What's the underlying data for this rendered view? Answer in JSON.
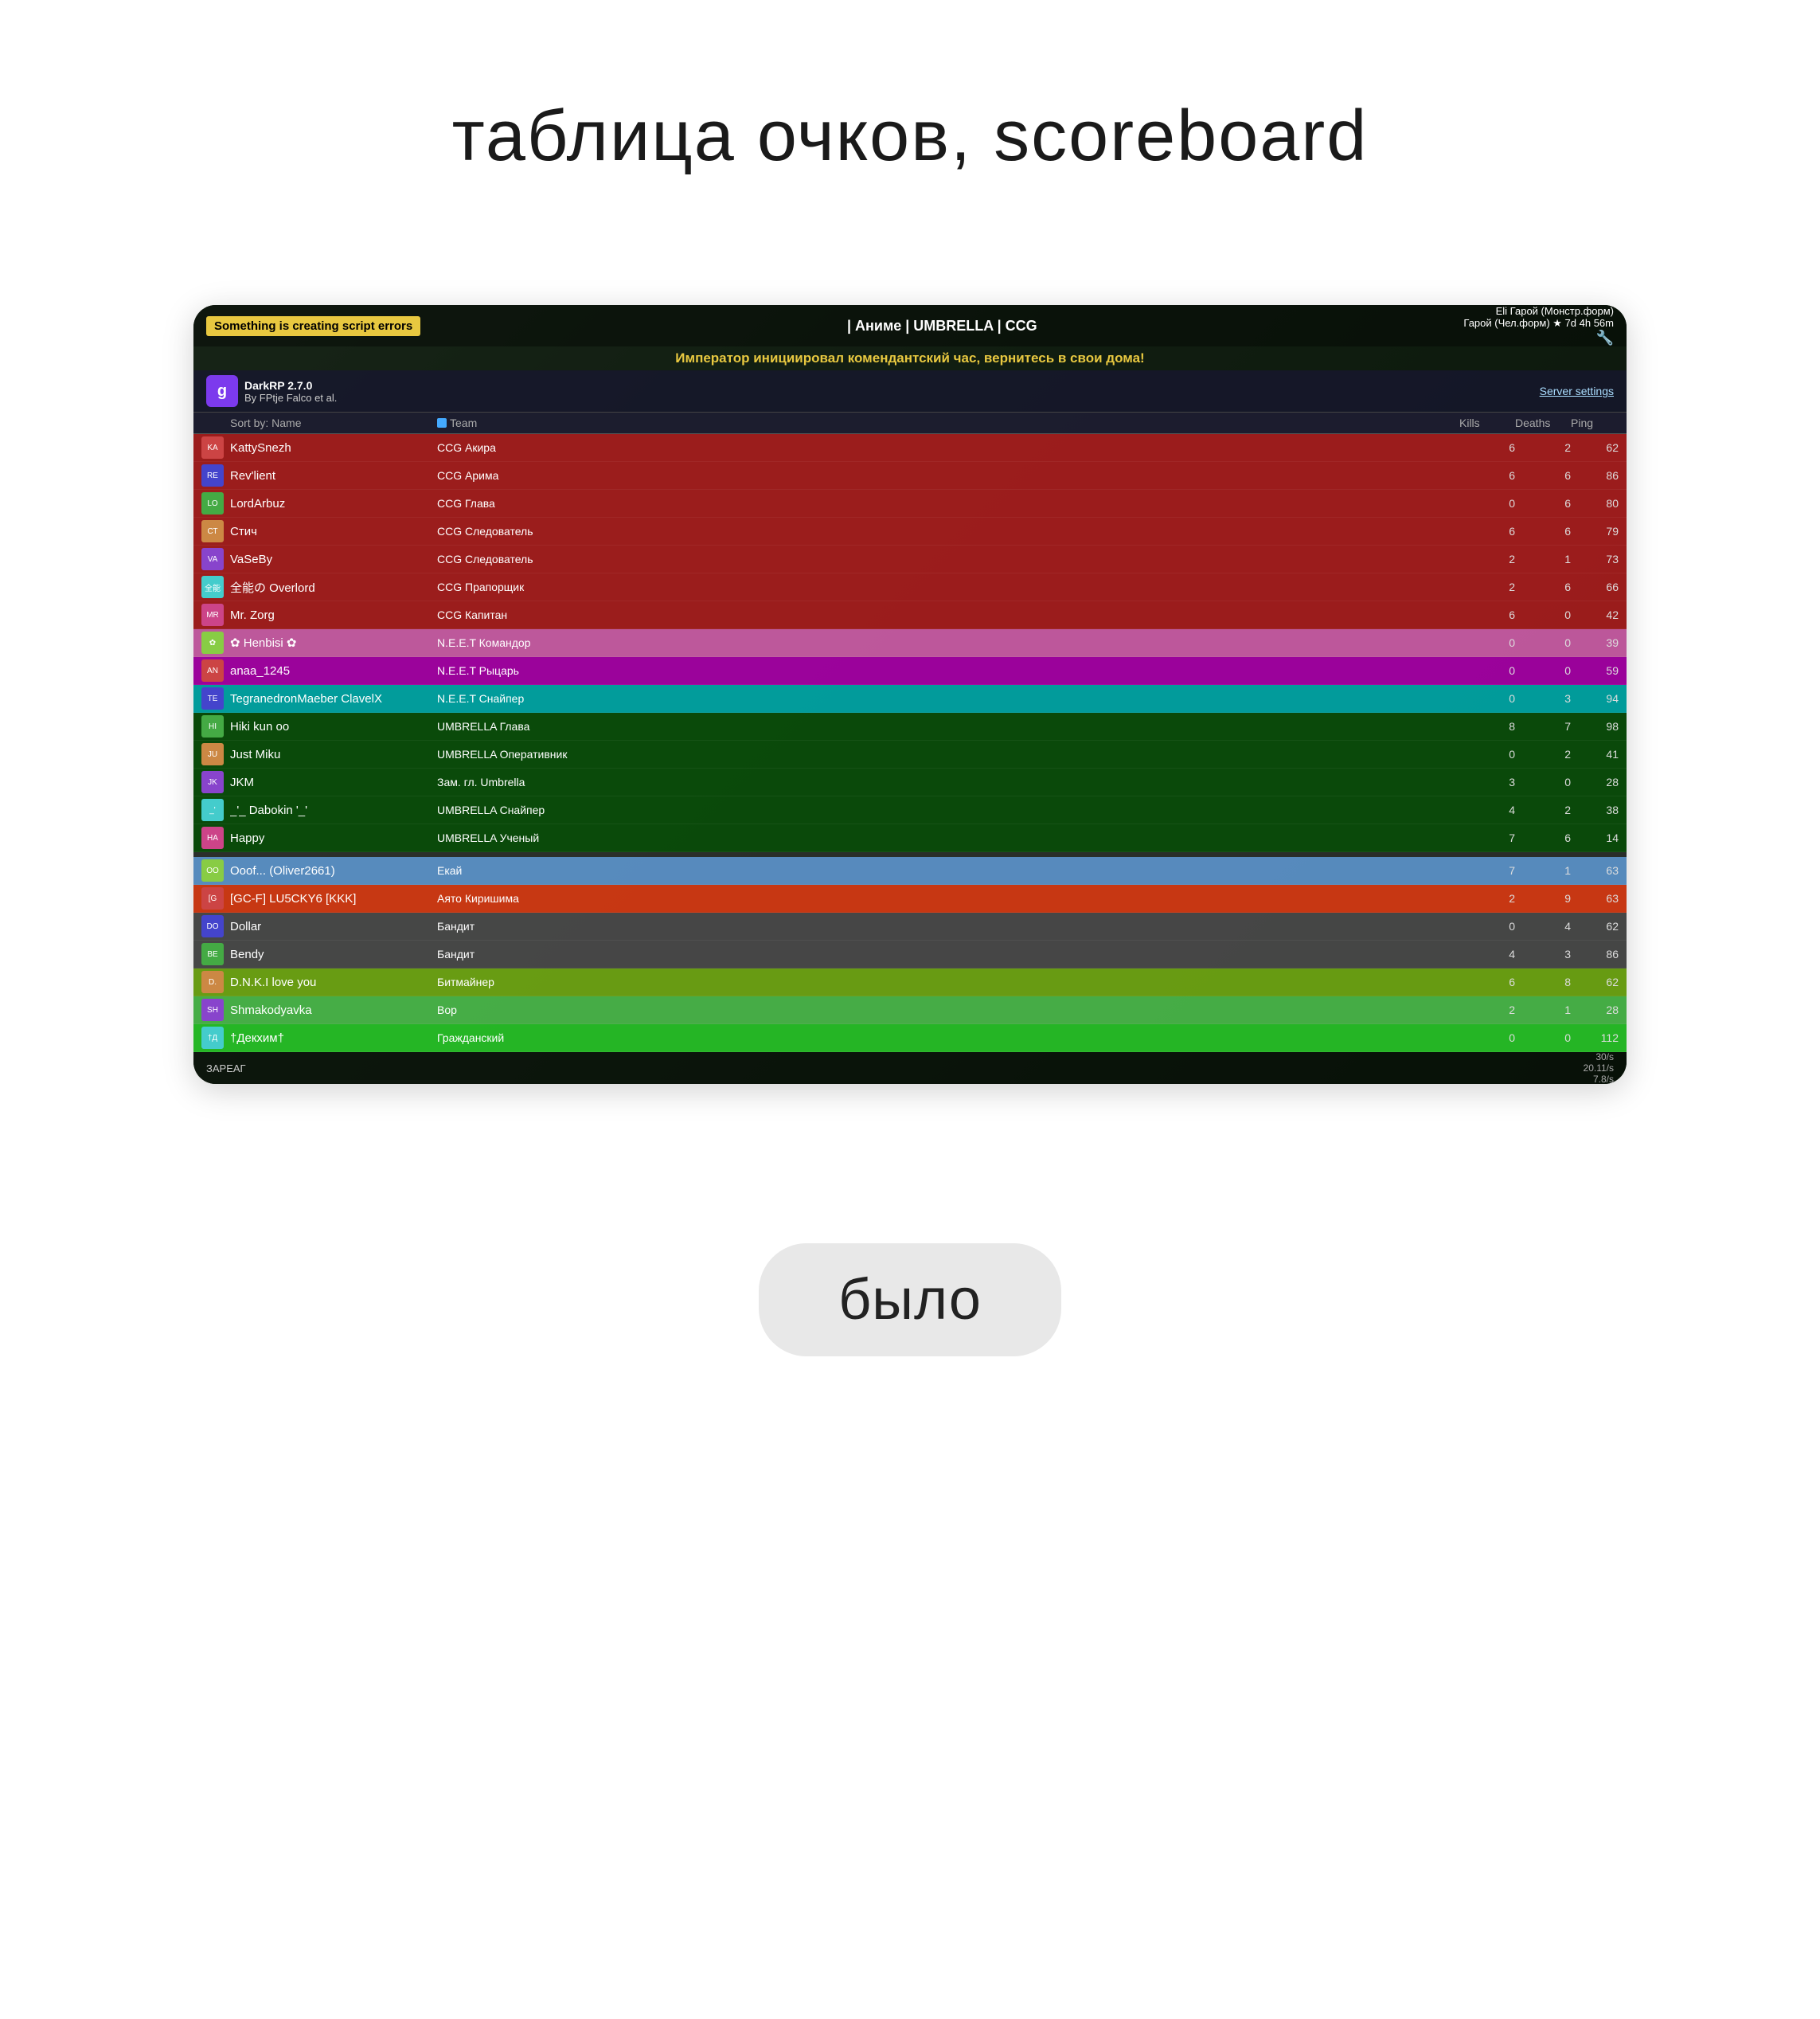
{
  "page": {
    "title": "таблица очков, scoreboard",
    "bylo_label": "было"
  },
  "game": {
    "script_error": "Something is creating script errors",
    "server_name": "| Аниме | UMBRELLA | CCG",
    "announcement": "Император инициировал комендантский час, вернитесь в свои дома!",
    "hero_info": "Eli Гарой (Монстр.форм)",
    "hero_sub": "Гарой (Чел.форм) ★ 7d 4h 56m",
    "server_settings": "Server settings",
    "darkrp_version": "DarkRP 2.7.0",
    "darkrp_by": "By FPtje Falco et al.",
    "sort_by": "Sort by:",
    "col_name": "Name",
    "col_team": "Team",
    "col_kills": "Kills",
    "col_deaths": "Deaths",
    "col_ping": "Ping"
  },
  "players": [
    {
      "name": "KattySnezh",
      "team": "CCG Акира",
      "kills": "6",
      "deaths": "2",
      "ping": "62",
      "color": "red"
    },
    {
      "name": "Rev'lient",
      "team": "CCG Арима",
      "kills": "6",
      "deaths": "6",
      "ping": "86",
      "color": "red"
    },
    {
      "name": "LordArbuz",
      "team": "CCG Глава",
      "kills": "0",
      "deaths": "6",
      "ping": "80",
      "color": "red"
    },
    {
      "name": "Стич",
      "team": "CCG Следователь",
      "kills": "6",
      "deaths": "6",
      "ping": "79",
      "color": "red"
    },
    {
      "name": "VaSeBy",
      "team": "CCG Следователь",
      "kills": "2",
      "deaths": "1",
      "ping": "73",
      "color": "red"
    },
    {
      "name": "全能の Overlord",
      "team": "CCG Прапорщик",
      "kills": "2",
      "deaths": "6",
      "ping": "66",
      "color": "red"
    },
    {
      "name": "Mr. Zorg",
      "team": "CCG Капитан",
      "kills": "6",
      "deaths": "0",
      "ping": "42",
      "color": "red"
    },
    {
      "name": "✿ Henbisi ✿",
      "team": "N.E.E.T Командор",
      "kills": "0",
      "deaths": "0",
      "ping": "39",
      "color": "pink"
    },
    {
      "name": "anaa_1245",
      "team": "N.E.E.T Рыцарь",
      "kills": "0",
      "deaths": "0",
      "ping": "59",
      "color": "magenta"
    },
    {
      "name": "TegranedronMaeber ClavelX",
      "team": "N.E.E.T Снайпер",
      "kills": "0",
      "deaths": "3",
      "ping": "94",
      "color": "cyan"
    },
    {
      "name": "Hiki kun oo",
      "team": "UMBRELLA Глава",
      "kills": "8",
      "deaths": "7",
      "ping": "98",
      "color": "dark-green"
    },
    {
      "name": "Just Miku",
      "team": "UMBRELLA Оперативник",
      "kills": "0",
      "deaths": "2",
      "ping": "41",
      "color": "dark-green"
    },
    {
      "name": "JKM",
      "team": "Зам. гл. Umbrella",
      "kills": "3",
      "deaths": "0",
      "ping": "28",
      "color": "dark-green"
    },
    {
      "name": "_'_ Dabokin '_'",
      "team": "UMBRELLA Снайпер",
      "kills": "4",
      "deaths": "2",
      "ping": "38",
      "color": "dark-green"
    },
    {
      "name": "Happy",
      "team": "UMBRELLA Ученый",
      "kills": "7",
      "deaths": "6",
      "ping": "14",
      "color": "dark-green"
    },
    {
      "name": "Ooof... (Oliver2661)",
      "team": "Екай",
      "kills": "7",
      "deaths": "1",
      "ping": "63",
      "color": "light-blue"
    },
    {
      "name": "[GC-F] LU5CKY6 [KKK]",
      "team": "Аято Киришима",
      "kills": "2",
      "deaths": "9",
      "ping": "63",
      "color": "orange-red"
    },
    {
      "name": "Dollar",
      "team": "Бандит",
      "kills": "0",
      "deaths": "4",
      "ping": "62",
      "color": "gray"
    },
    {
      "name": "Bendy",
      "team": "Бандит",
      "kills": "4",
      "deaths": "3",
      "ping": "86",
      "color": "gray"
    },
    {
      "name": "D.N.K.I love you",
      "team": "Битмайнер",
      "kills": "6",
      "deaths": "8",
      "ping": "62",
      "color": "yellow-green"
    },
    {
      "name": "Shmakodyavka",
      "team": "Вор",
      "kills": "2",
      "deaths": "1",
      "ping": "28",
      "color": "lime"
    },
    {
      "name": "†Декхим†",
      "team": "Гражданский",
      "kills": "0",
      "deaths": "0",
      "ping": "112",
      "color": "bright-green"
    }
  ],
  "hud": {
    "left": "ЗАРЕАГ",
    "fps": "30/s",
    "network": "20.11/s",
    "extra": "7.8/s"
  }
}
